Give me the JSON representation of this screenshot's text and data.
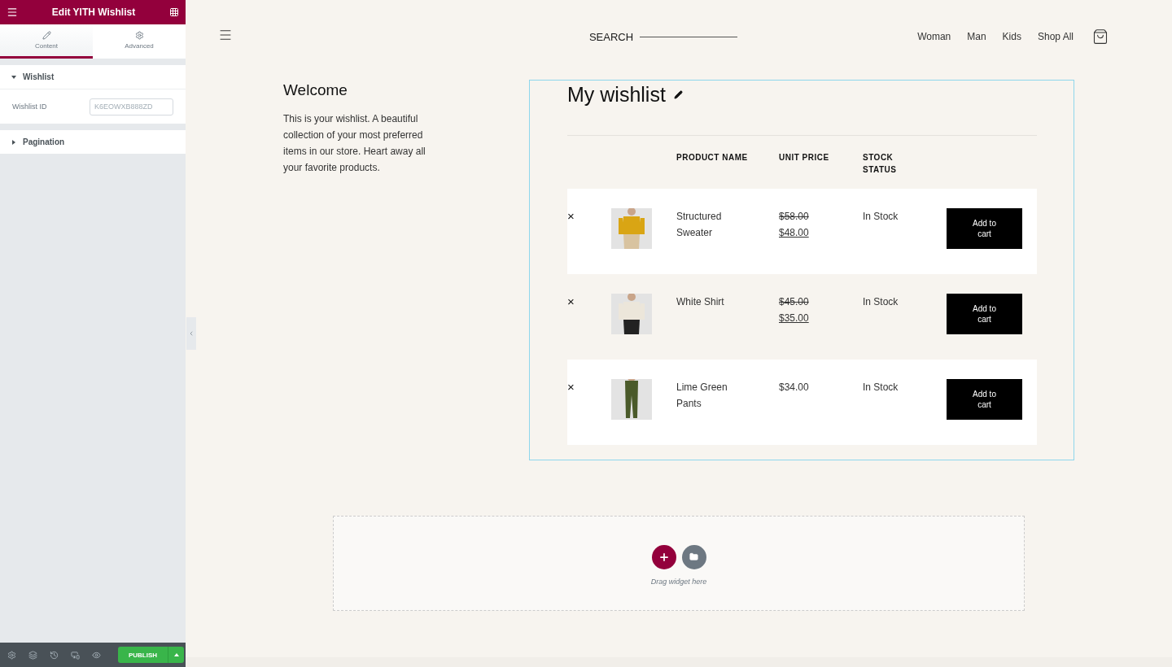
{
  "panel": {
    "title": "Edit YITH Wishlist",
    "tabs": [
      {
        "label": "Content",
        "selected": true
      },
      {
        "label": "Advanced",
        "selected": false
      }
    ],
    "sections": [
      {
        "title": "Wishlist",
        "expanded": true,
        "fields": [
          {
            "label": "Wishlist ID",
            "placeholder": "K6EOWXB888ZD"
          }
        ]
      },
      {
        "title": "Pagination",
        "expanded": false
      }
    ],
    "publish": "PUBLISH"
  },
  "header": {
    "search": "SEARCH",
    "nav": [
      "Woman",
      "Man",
      "Kids",
      "Shop All"
    ]
  },
  "intro": {
    "title": "Welcome",
    "text": "This is your wishlist. A beautiful collection of your most preferred items in our store. Heart away all your favorite products."
  },
  "wishlist": {
    "title": "My wishlist",
    "columns": [
      "PRODUCT NAME",
      "UNIT PRICE",
      "STOCK STATUS"
    ],
    "rows": [
      {
        "remove": "×",
        "name": "Structured Sweater",
        "old_price": "$58.00",
        "price": "$48.00",
        "stock": "In Stock",
        "action": "Add to cart"
      },
      {
        "remove": "×",
        "name": "White Shirt",
        "old_price": "$45.00",
        "price": "$35.00",
        "stock": "In Stock",
        "action": "Add to cart"
      },
      {
        "remove": "×",
        "name": "Lime Green Pants",
        "price": "$34.00",
        "stock": "In Stock",
        "action": "Add to cart"
      }
    ]
  },
  "dropzone": {
    "hint": "Drag widget here"
  }
}
